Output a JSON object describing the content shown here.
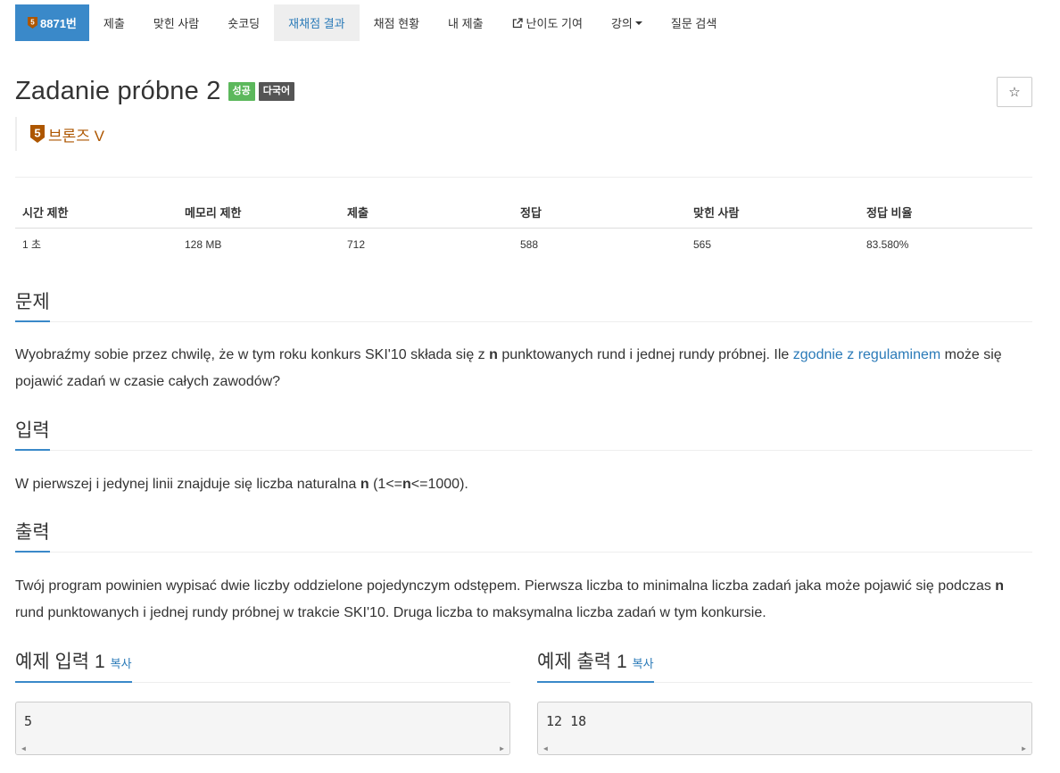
{
  "nav": {
    "problem_badge": "5",
    "problem_number": "8871번",
    "items": [
      {
        "label": "제출"
      },
      {
        "label": "맞힌 사람"
      },
      {
        "label": "숏코딩"
      },
      {
        "label": "재채점 결과"
      },
      {
        "label": "채점 현황"
      },
      {
        "label": "내 제출"
      },
      {
        "label": "난이도 기여"
      },
      {
        "label": "강의"
      },
      {
        "label": "질문 검색"
      }
    ],
    "active_item": "재채점 결과"
  },
  "problem": {
    "title": "Zadanie próbne 2",
    "labels": {
      "success": "성공",
      "multilang": "다국어"
    },
    "star": "☆",
    "tier_badge": "5",
    "tier": "브론즈 V"
  },
  "stats": {
    "headers": [
      "시간 제한",
      "메모리 제한",
      "제출",
      "정답",
      "맞힌 사람",
      "정답 비율"
    ],
    "values": [
      "1 초",
      "128 MB",
      "712",
      "588",
      "565",
      "83.580%"
    ]
  },
  "sections": {
    "description": {
      "title": "문제",
      "text_1": "Wyobraźmy sobie przez chwilę, że w tym roku konkurs SKI'10 składa się z ",
      "var_n": "n",
      "text_2": " punktowanych rund i jednej rundy próbnej. Ile ",
      "link": "zgodnie z regulaminem",
      "text_3": " może się pojawić zadań w czasie całych zawodów?"
    },
    "input": {
      "title": "입력",
      "text_1": "W pierwszej i jedynej linii znajduje się liczba naturalna ",
      "var_n": "n",
      "text_2": " (1<=",
      "var_n2": "n",
      "text_3": "<=1000)."
    },
    "output": {
      "title": "출력",
      "text_1": "Twój program powinien wypisać dwie liczby oddzielone pojedynczym odstępem. Pierwsza liczba to minimalna liczba zadań jaka może pojawić się podczas ",
      "var_n": "n",
      "text_2": " rund punktowanych i jednej rundy próbnej w trakcie SKI'10. Druga liczba to maksymalna liczba zadań w tym konkursie."
    }
  },
  "samples": {
    "input": {
      "title": "예제 입력 1",
      "copy": "복사",
      "value": "5"
    },
    "output": {
      "title": "예제 출력 1",
      "copy": "복사",
      "value": "12 18"
    }
  },
  "colors": {
    "primary": "#3a89c9",
    "tier_bronze": "#ad5600",
    "success": "#5cb85c",
    "multilang": "#555555"
  }
}
